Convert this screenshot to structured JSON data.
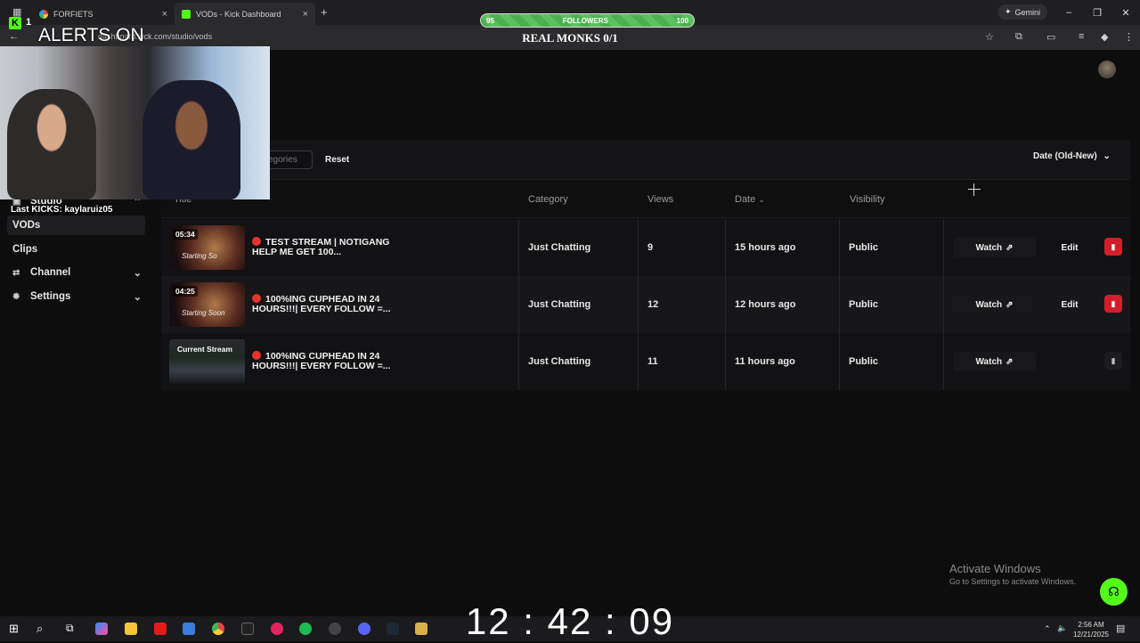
{
  "browser": {
    "tabs": [
      {
        "label": "FORFIETS"
      },
      {
        "label": "VODs - Kick Dashboard"
      }
    ],
    "new_tab_symbol": "+",
    "close_symbol": "×",
    "url": "dashboard.kick.com/studio/vods",
    "gemini_label": "Gemini",
    "window_controls": [
      "–",
      "❐",
      "✕"
    ]
  },
  "overlay": {
    "kick_count": "1",
    "alerts_text": "ALERTS ON",
    "last_kicks": "Last KICKS: kaylaruiz05",
    "followers": {
      "left": "95",
      "label": "FOLLOWERS",
      "right": "100",
      "fill_fraction": 0.95
    },
    "monks_text": "REAL MONKS 0/1",
    "clock": "12 : 42 : 09"
  },
  "sidebar": {
    "items": [
      {
        "label": "Studio",
        "icon": "studio-icon",
        "chevron": "⌃"
      },
      {
        "label": "VODs"
      },
      {
        "label": "Clips"
      },
      {
        "label": "Channel",
        "icon": "channel-icon",
        "chevron": "⌄"
      },
      {
        "label": "Settings",
        "icon": "gear-icon",
        "chevron": "⌄"
      }
    ]
  },
  "filters": {
    "category_placeholder": "egories",
    "reset_label": "Reset",
    "sort_label": "Date (Old-New)"
  },
  "table": {
    "headers": {
      "title": "Title",
      "category": "Category",
      "views": "Views",
      "date": "Date",
      "visibility": "Visibility"
    },
    "rows": [
      {
        "thumb_label": "05:34",
        "thumb_watermark": "Starting So",
        "title_line1": "TEST STREAM | NOTIGANG",
        "title_line2": "HELP ME GET 100...",
        "category": "Just Chatting",
        "views": "9",
        "date": "15 hours ago",
        "visibility": "Public",
        "watch": "Watch",
        "edit": "Edit",
        "delete_enabled": true
      },
      {
        "thumb_label": "04:25",
        "thumb_watermark": "Starting Soon",
        "title_line1": "100%ING CUPHEAD IN 24",
        "title_line2": "HOURS!!!| EVERY FOLLOW =...",
        "category": "Just Chatting",
        "views": "12",
        "date": "12 hours ago",
        "visibility": "Public",
        "watch": "Watch",
        "edit": "Edit",
        "delete_enabled": true
      },
      {
        "thumb_label": "Current Stream",
        "thumb_watermark": "",
        "title_line1": "100%ING CUPHEAD IN 24",
        "title_line2": "HOURS!!!| EVERY FOLLOW =...",
        "category": "Just Chatting",
        "views": "11",
        "date": "11 hours ago",
        "visibility": "Public",
        "watch": "Watch",
        "edit": "",
        "delete_enabled": false
      }
    ]
  },
  "windows": {
    "activate_title": "Activate Windows",
    "activate_sub": "Go to Settings to activate Windows.",
    "tray_time": "2:56 AM",
    "tray_date": "12/21/2025"
  },
  "colors": {
    "kick_green": "#53fc18",
    "delete_red": "#d21e2b",
    "live_dot": "#e5342b"
  }
}
